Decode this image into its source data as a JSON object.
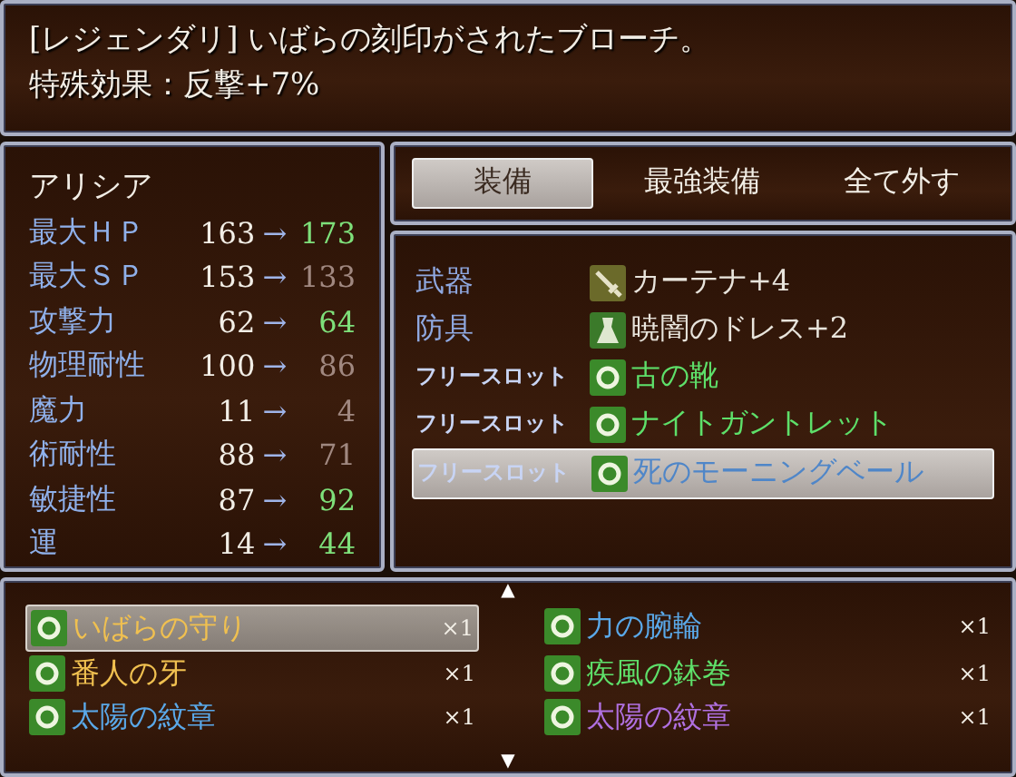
{
  "help": {
    "lines": [
      "[レジェンダリ] いばらの刻印がされたブローチ。",
      "特殊効果：反撃+7%"
    ]
  },
  "status": {
    "actor": "アリシア",
    "stats": [
      {
        "label": "最大ＨＰ",
        "current": "163",
        "arrow": "→",
        "new": "173",
        "color": "#7ee07a"
      },
      {
        "label": "最大ＳＰ",
        "current": "153",
        "arrow": "→",
        "new": "133",
        "color": "#a08880"
      },
      {
        "label": "攻撃力",
        "current": "62",
        "arrow": "→",
        "new": "64",
        "color": "#7ee07a"
      },
      {
        "label": "物理耐性",
        "current": "100",
        "arrow": "→",
        "new": "86",
        "color": "#a08880"
      },
      {
        "label": "魔力",
        "current": "11",
        "arrow": "→",
        "new": "4",
        "color": "#a08880"
      },
      {
        "label": "術耐性",
        "current": "88",
        "arrow": "→",
        "new": "71",
        "color": "#a08880"
      },
      {
        "label": "敏捷性",
        "current": "87",
        "arrow": "→",
        "new": "92",
        "color": "#7ee07a"
      },
      {
        "label": "運",
        "current": "14",
        "arrow": "→",
        "new": "44",
        "color": "#7ee07a"
      }
    ]
  },
  "commands": [
    {
      "label": "装備",
      "selected": true
    },
    {
      "label": "最強装備",
      "selected": false
    },
    {
      "label": "全て外す",
      "selected": false
    }
  ],
  "slots": [
    {
      "slot": "武器",
      "item": "カーテナ+4",
      "color": "#e8e4dc",
      "kind": "weapon",
      "selected": false
    },
    {
      "slot": "防具",
      "item": "暁闇のドレス+2",
      "color": "#e8e4dc",
      "kind": "armor",
      "selected": false
    },
    {
      "slot": "フリースロット",
      "item": "古の靴",
      "color": "#5ee06a",
      "kind": "free",
      "selected": false
    },
    {
      "slot": "フリースロット",
      "item": "ナイトガントレット",
      "color": "#5ee06a",
      "kind": "free",
      "selected": false
    },
    {
      "slot": "フリースロット",
      "item": "死のモーニングベール",
      "color": "#4f86c8",
      "kind": "free",
      "selected": true
    }
  ],
  "items": {
    "scroll_up": "▲",
    "scroll_down": "▼",
    "entries": [
      {
        "name": "いばらの守り",
        "count": "×1",
        "color": "#f0c050",
        "selected": true
      },
      {
        "name": "力の腕輪",
        "count": "×1",
        "color": "#5aa8e8",
        "selected": false
      },
      {
        "name": "番人の牙",
        "count": "×1",
        "color": "#f0c050",
        "selected": false
      },
      {
        "name": "疾風の鉢巻",
        "count": "×1",
        "color": "#5ee06a",
        "selected": false
      },
      {
        "name": "太陽の紋章",
        "count": "×1",
        "color": "#5aa8e8",
        "selected": false
      },
      {
        "name": "太陽の紋章",
        "count": "×1",
        "color": "#b070e0",
        "selected": false
      }
    ]
  }
}
